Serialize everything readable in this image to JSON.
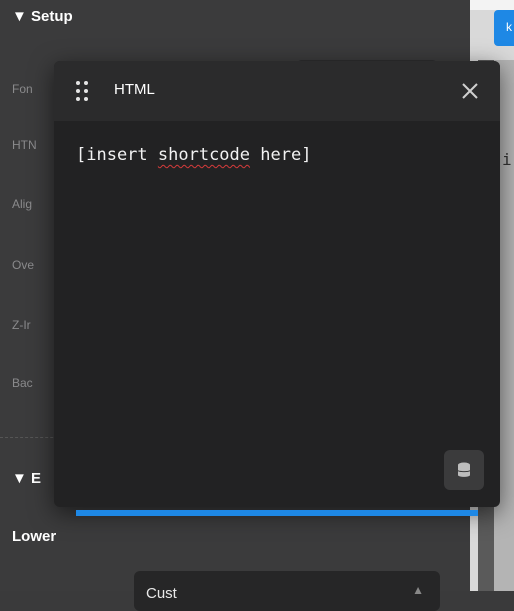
{
  "panel": {
    "setup_heading": "▼ Setup",
    "rows": [
      "Fon",
      "HTN",
      "Alig",
      "Ove",
      "Z-Ir",
      "Bac"
    ],
    "b_heading": "▼ E",
    "lower_label": "Lower",
    "select_value": "Cust"
  },
  "strip": {
    "tab_char": "k",
    "edge_char": "i"
  },
  "modal": {
    "title": "HTML",
    "code_prefix": "[insert ",
    "code_misspelled": "shortcode",
    "code_suffix": " here]"
  },
  "colors": {
    "accent": "#1e88e5",
    "modal_bg": "#222223",
    "header_bg": "#2b2b2c",
    "panel_bg": "#3b3b3c",
    "spell_error": "#d53b3b"
  },
  "icons": {
    "drag": "drag-handle-icon",
    "close": "close-icon",
    "database": "database-icon"
  }
}
